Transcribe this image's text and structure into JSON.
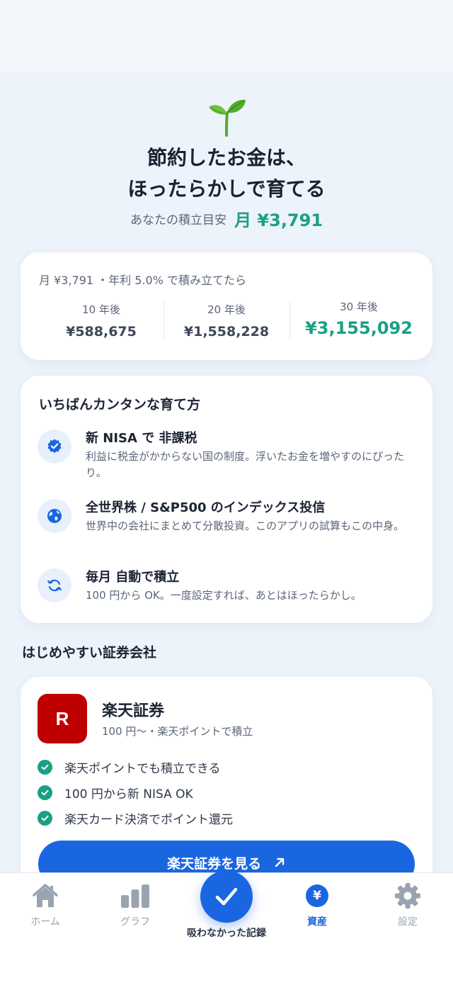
{
  "hero": {
    "icon": "seedling-icon",
    "headline_line1": "節約したお金は、",
    "headline_line2": "ほったらかしで育てる",
    "target_label": "あなたの積立目安",
    "target_value": "月 ¥3,791"
  },
  "simulation": {
    "header": "月 ¥3,791 ・年利 5.0% で積み立てたら",
    "columns": [
      {
        "years": "10 年後",
        "amount": "¥588,675"
      },
      {
        "years": "20 年後",
        "amount": "¥1,558,228"
      },
      {
        "years": "30 年後",
        "amount": "¥3,155,092"
      }
    ]
  },
  "ways": {
    "title": "いちばんカンタンな育て方",
    "items": [
      {
        "icon": "verified-badge-icon",
        "title": "新 NISA で 非課税",
        "desc": "利益に税金がかからない国の制度。浮いたお金を増やすのにぴったり。"
      },
      {
        "icon": "globe-icon",
        "title": "全世界株 / S&P500 のインデックス投信",
        "desc": "世界中の会社にまとめて分散投資。このアプリの試算もこの中身。"
      },
      {
        "icon": "refresh-icon",
        "title": "毎月 自動で積立",
        "desc": "100 円から OK。一度設定すれば、あとはほったらかし。"
      }
    ]
  },
  "brokers_section": {
    "title": "はじめやすい証券会社"
  },
  "broker": {
    "logo_letter": "R",
    "name": "楽天証券",
    "subtitle": "100 円〜・楽天ポイントで積立",
    "features": [
      "楽天ポイントでも積立できる",
      "100 円から新 NISA OK",
      "楽天カード決済でポイント還元"
    ],
    "cta_label": "楽天証券を見る",
    "cta_icon": "external-arrow-icon"
  },
  "colors": {
    "accent_green": "#1aa085",
    "primary_blue": "#1a66e0",
    "rakuten_red": "#bf0000",
    "inactive_gray": "#9aa3b1"
  },
  "tabbar": {
    "tabs": [
      {
        "label": "ホーム",
        "icon": "home-icon",
        "active": false
      },
      {
        "label": "グラフ",
        "icon": "bar-chart-icon",
        "active": false
      },
      {
        "label": "吸わなかった記録",
        "icon": "check-icon",
        "active": false
      },
      {
        "label": "資産",
        "icon": "yen-icon",
        "active": true
      },
      {
        "label": "設定",
        "icon": "gear-icon",
        "active": false
      }
    ]
  }
}
